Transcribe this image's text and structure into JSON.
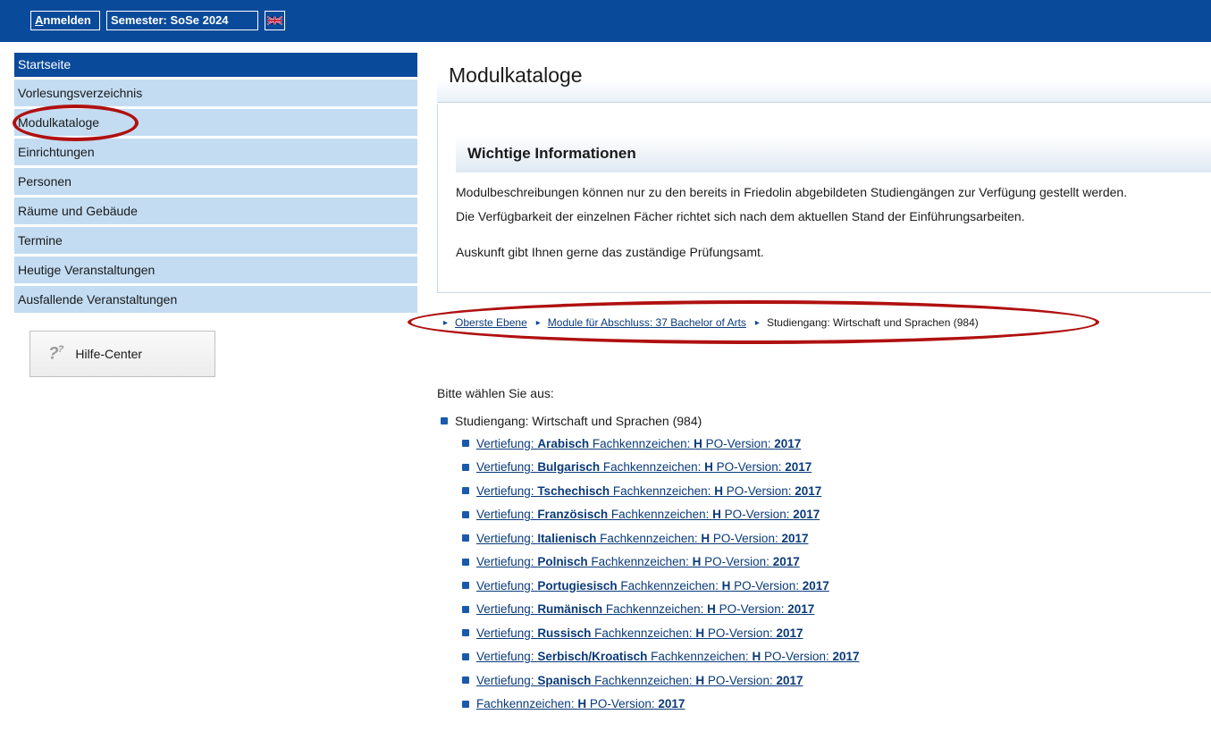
{
  "topbar": {
    "login_label_underlined": "A",
    "login_label_rest": "nmelden",
    "semester_label": "Semester: SoSe 2024",
    "language_flag": "uk-flag-icon"
  },
  "sidebar": {
    "items": [
      {
        "label": "Startseite",
        "active": true
      },
      {
        "label": "Vorlesungsverzeichnis"
      },
      {
        "label": "Modulkataloge"
      },
      {
        "label": "Einrichtungen"
      },
      {
        "label": "Personen"
      },
      {
        "label": "Räume und Gebäude"
      },
      {
        "label": "Termine"
      },
      {
        "label": "Heutige Veranstaltungen"
      },
      {
        "label": "Ausfallende Veranstaltungen"
      }
    ],
    "help": {
      "icon": "question-marks-icon",
      "label": "Hilfe-Center"
    }
  },
  "main": {
    "title": "Modulkataloge",
    "info": {
      "heading": "Wichtige Informationen",
      "line1": "Modulbeschreibungen können nur zu den bereits in Friedolin abgebildeten Studiengängen zur Verfügung gestellt werden.",
      "line2": "Die Verfügbarkeit der einzelnen Fächer richtet sich nach dem aktuellen Stand der Einführungsarbeiten.",
      "line3": "Auskunft gibt Ihnen gerne das zuständige Prüfungsamt."
    },
    "breadcrumb": {
      "items": [
        "Oberste Ebene",
        "Module für Abschluss: 37 Bachelor of Arts"
      ],
      "current": "Studiengang: Wirtschaft und Sprachen (984)"
    },
    "choose_label": "Bitte wählen Sie aus:",
    "tree": {
      "root": "Studiengang: Wirtschaft und Sprachen (984)",
      "prefix": "Vertiefung: ",
      "fk_label": " Fachkennzeichen: ",
      "fk_value": "H",
      "po_label": " PO-Version: ",
      "po_value": "2017",
      "languages": [
        "Arabisch",
        "Bulgarisch",
        "Tschechisch",
        "Französisch",
        "Italienisch",
        "Polnisch",
        "Portugiesisch",
        "Rumänisch",
        "Russisch",
        "Serbisch/Kroatisch",
        "Spanisch"
      ],
      "last_fk_label": "Fachkennzeichen: "
    }
  },
  "colors": {
    "brand_blue": "#0a4a9a",
    "sidebar_bg": "#c3dcf2",
    "annotation_red": "#b01010"
  }
}
